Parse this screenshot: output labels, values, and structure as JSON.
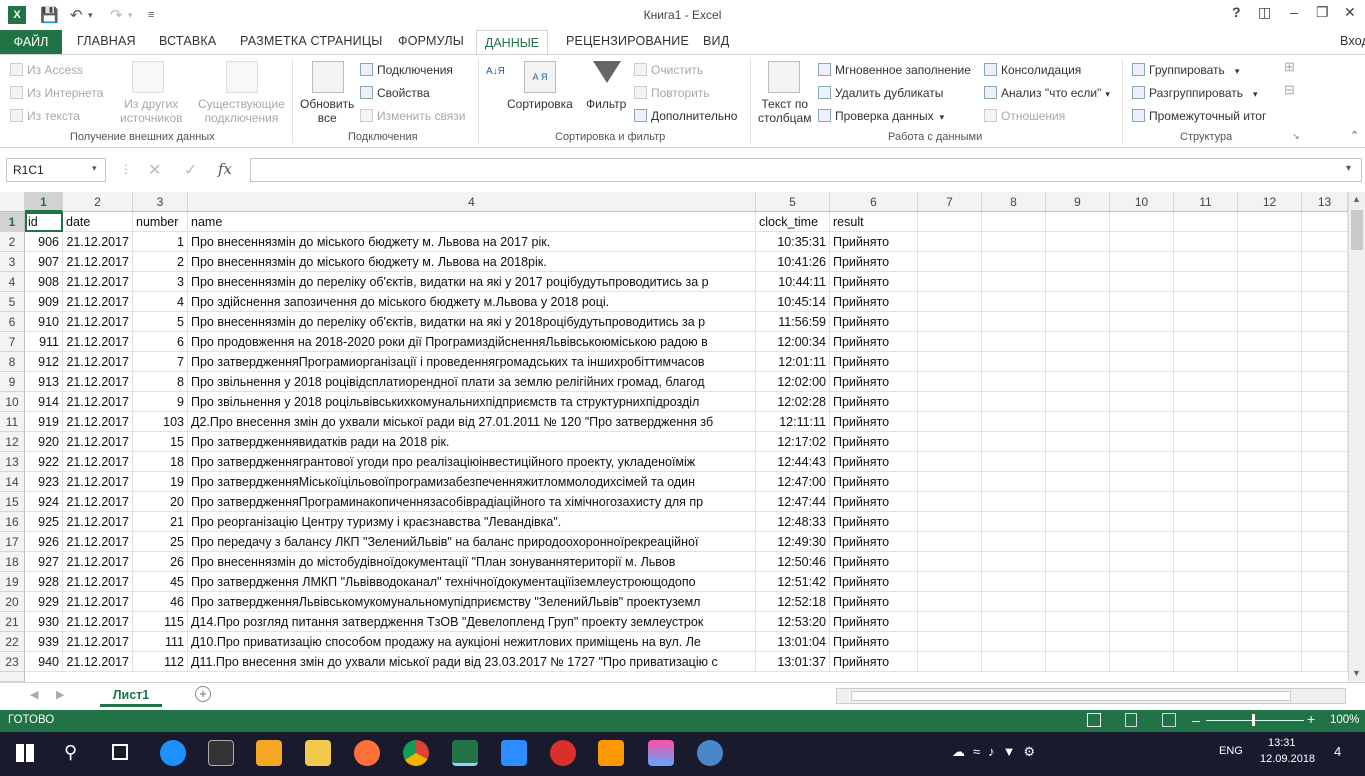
{
  "window": {
    "title": "Книга1 - Excel",
    "help": "?",
    "user": "Вход"
  },
  "tabs": [
    "ФАЙЛ",
    "ГЛАВНАЯ",
    "ВСТАВКА",
    "РАЗМЕТКА СТРАНИЦЫ",
    "ФОРМУЛЫ",
    "ДАННЫЕ",
    "РЕЦЕНЗИРОВАНИЕ",
    "ВИД"
  ],
  "ribbon": {
    "ext": {
      "access": "Из Access",
      "web": "Из Интернета",
      "text": "Из текста",
      "other1": "Из других",
      "other2": "источников",
      "exist1": "Существующие",
      "exist2": "подключения",
      "group": "Получение внешних данных"
    },
    "conn": {
      "refresh1": "Обновить",
      "refresh2": "все",
      "connections": "Подключения",
      "props": "Свойства",
      "editlinks": "Изменить связи",
      "group": "Подключения"
    },
    "sort": {
      "sort": "Сортировка",
      "filter": "Фильтр",
      "clear": "Очистить",
      "reapply": "Повторить",
      "advanced": "Дополнительно",
      "group": "Сортировка и фильтр",
      "az": "А↓Я",
      "azbox": "А Я"
    },
    "tools": {
      "t2c1": "Текст по",
      "t2c2": "столбцам",
      "flash": "Мгновенное заполнение",
      "dups": "Удалить дубликаты",
      "validate": "Проверка данных",
      "consol": "Консолидация",
      "whatif": "Анализ \"что если\"",
      "rel": "Отношения",
      "group": "Работа с данными"
    },
    "outline": {
      "group_btn": "Группировать",
      "ungroup": "Разгруппировать",
      "subtotal": "Промежуточный итог",
      "group": "Структура"
    }
  },
  "formula": {
    "namebox": "R1C1",
    "fx": "fx",
    "value": ""
  },
  "columns": [
    "1",
    "2",
    "3",
    "4",
    "5",
    "6",
    "7",
    "8",
    "9",
    "10",
    "11",
    "12",
    "13"
  ],
  "rows": [
    {
      "n": "1",
      "id": "id",
      "date": "date",
      "number": "number",
      "name": "name",
      "time": "clock_time",
      "result": "result"
    },
    {
      "n": "2",
      "id": "906",
      "date": "21.12.2017",
      "number": "1",
      "name": "Про внесеннязмін до міського бюджету м. Львова на 2017 рік.",
      "time": "10:35:31",
      "result": "Прийнято"
    },
    {
      "n": "3",
      "id": "907",
      "date": "21.12.2017",
      "number": "2",
      "name": "Про внесеннязмін до міського бюджету м. Львова на 2018рік.",
      "time": "10:41:26",
      "result": "Прийнято"
    },
    {
      "n": "4",
      "id": "908",
      "date": "21.12.2017",
      "number": "3",
      "name": "Про внесеннязмін до переліку об'єктів, видатки на які у 2017 роцібудутьпроводитись за р",
      "time": "10:44:11",
      "result": "Прийнято"
    },
    {
      "n": "5",
      "id": "909",
      "date": "21.12.2017",
      "number": "4",
      "name": "Про здійснення запозичення до міського бюджету м.Львова у 2018 році.",
      "time": "10:45:14",
      "result": "Прийнято"
    },
    {
      "n": "6",
      "id": "910",
      "date": "21.12.2017",
      "number": "5",
      "name": "Про внесеннязмін до переліку об'єктів, видатки на які у 2018роцібудутьпроводитись за р",
      "time": "11:56:59",
      "result": "Прийнято"
    },
    {
      "n": "7",
      "id": "911",
      "date": "21.12.2017",
      "number": "6",
      "name": "Про продовження на 2018-2020 роки дії ПрограмиздійсненняЛьвівськоюміською радою в",
      "time": "12:00:34",
      "result": "Прийнято"
    },
    {
      "n": "8",
      "id": "912",
      "date": "21.12.2017",
      "number": "7",
      "name": "Про затвердженняПрограмиорганізації і проведеннягромадських та іншихробіттимчасов",
      "time": "12:01:11",
      "result": "Прийнято"
    },
    {
      "n": "9",
      "id": "913",
      "date": "21.12.2017",
      "number": "8",
      "name": "Про звільнення у 2018 роцівідсплатиорендної плати за землю релігійних громад, благод",
      "time": "12:02:00",
      "result": "Прийнято"
    },
    {
      "n": "10",
      "id": "914",
      "date": "21.12.2017",
      "number": "9",
      "name": "Про звільнення у 2018 роцільвівськихкомунальнихпідприємств та структурнихпідрозділ",
      "time": "12:02:28",
      "result": "Прийнято"
    },
    {
      "n": "11",
      "id": "919",
      "date": "21.12.2017",
      "number": "103",
      "name": "Д2.Про внесення змін до ухвали міської ради від 27.01.2011 № 120 \"Про затвердження зб",
      "time": "12:11:11",
      "result": "Прийнято"
    },
    {
      "n": "12",
      "id": "920",
      "date": "21.12.2017",
      "number": "15",
      "name": "Про затвердженнявидатків ради на 2018 рік.",
      "time": "12:17:02",
      "result": "Прийнято"
    },
    {
      "n": "13",
      "id": "922",
      "date": "21.12.2017",
      "number": "18",
      "name": "Про затвердженнягрантової угоди про реалізаціюінвестиційного проекту, укладеноїміж",
      "time": "12:44:43",
      "result": "Прийнято"
    },
    {
      "n": "14",
      "id": "923",
      "date": "21.12.2017",
      "number": "19",
      "name": "Про затвердженняМіськоїцільовоїпрограмизабезпеченняжитломмолодихсімей та один",
      "time": "12:47:00",
      "result": "Прийнято"
    },
    {
      "n": "15",
      "id": "924",
      "date": "21.12.2017",
      "number": "20",
      "name": "Про затвердженняПрограминакопиченнязасобіврадіаційного та хімічногозахисту для пр",
      "time": "12:47:44",
      "result": "Прийнято"
    },
    {
      "n": "16",
      "id": "925",
      "date": "21.12.2017",
      "number": "21",
      "name": "Про реорганізацію Центру туризму і краєзнавства \"Левандівка\".",
      "time": "12:48:33",
      "result": "Прийнято"
    },
    {
      "n": "17",
      "id": "926",
      "date": "21.12.2017",
      "number": "25",
      "name": "Про передачу з балансу ЛКП \"ЗеленийЛьвів\" на баланс природоохоронноїрекреаційної",
      "time": "12:49:30",
      "result": "Прийнято"
    },
    {
      "n": "18",
      "id": "927",
      "date": "21.12.2017",
      "number": "26",
      "name": "Про внесеннязмін до містобудівноїдокументації \"План зонуваннятериторії м. Львов",
      "time": "12:50:46",
      "result": "Прийнято"
    },
    {
      "n": "19",
      "id": "928",
      "date": "21.12.2017",
      "number": "45",
      "name": "Про затвердження ЛМКП \"Львівводоканал\" технічноїдокументаціїіземлеустроющодопо",
      "time": "12:51:42",
      "result": "Прийнято"
    },
    {
      "n": "20",
      "id": "929",
      "date": "21.12.2017",
      "number": "46",
      "name": "Про затвердженняЛьвівськомукомунальномупідприємству \"ЗеленийЛьвів\" проектуземл",
      "time": "12:52:18",
      "result": "Прийнято"
    },
    {
      "n": "21",
      "id": "930",
      "date": "21.12.2017",
      "number": "115",
      "name": "Д14.Про розгляд питання затвердження ТзОВ \"Девелопленд Груп\" проекту землеустрок",
      "time": "12:53:20",
      "result": "Прийнято"
    },
    {
      "n": "22",
      "id": "939",
      "date": "21.12.2017",
      "number": "111",
      "name": "Д10.Про приватизацію способом продажу на аукціоні нежитлових приміщень на вул. Ле",
      "time": "13:01:04",
      "result": "Прийнято"
    },
    {
      "n": "23",
      "id": "940",
      "date": "21.12.2017",
      "number": "112",
      "name": "Д11.Про внесення змін до ухвали міської ради від 23.03.2017 № 1727 \"Про приватизацію с",
      "time": "13:01:37",
      "result": "Прийнято"
    }
  ],
  "sheet": {
    "tab": "Лист1",
    "add": "+"
  },
  "status": {
    "ready": "ГОТОВО",
    "zoom": "100%"
  },
  "taskbar": {
    "lang": "ENG",
    "time": "13:31",
    "date": "12.09.2018",
    "notif": "4"
  }
}
